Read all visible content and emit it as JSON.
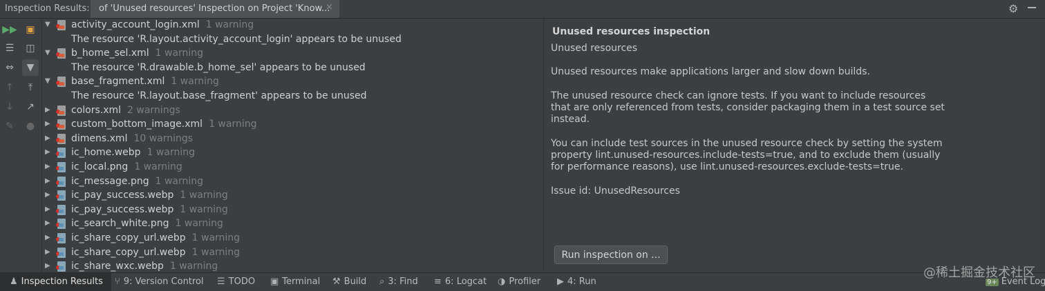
{
  "title_bar": {
    "label": "Inspection Results:",
    "tab_title": "of 'Unused resources' Inspection on Project 'Know...",
    "tab_close": "×"
  },
  "tree": [
    {
      "type": "file",
      "name": "activity_account_login.xml",
      "count": "1 warning",
      "icon": "xml-file-icon",
      "expanded": true
    },
    {
      "type": "message",
      "text": "The resource 'R.layout.activity_account_login' appears to be unused"
    },
    {
      "type": "file",
      "name": "b_home_sel.xml",
      "count": "1 warning",
      "icon": "xml-file-icon",
      "expanded": true
    },
    {
      "type": "message",
      "text": "The resource 'R.drawable.b_home_sel' appears to be unused"
    },
    {
      "type": "file",
      "name": "base_fragment.xml",
      "count": "1 warning",
      "icon": "xml-file-icon",
      "expanded": true
    },
    {
      "type": "message",
      "text": "The resource 'R.layout.base_fragment' appears to be unused"
    },
    {
      "type": "file",
      "name": "colors.xml",
      "count": "2 warnings",
      "icon": "xml-file-icon",
      "expanded": false
    },
    {
      "type": "file",
      "name": "custom_bottom_image.xml",
      "count": "1 warning",
      "icon": "xml-file-icon",
      "expanded": false
    },
    {
      "type": "file",
      "name": "dimens.xml",
      "count": "10 warnings",
      "icon": "xml-file-icon",
      "expanded": false
    },
    {
      "type": "file",
      "name": "ic_home.webp",
      "count": "1 warning",
      "icon": "image-file-icon",
      "expanded": false
    },
    {
      "type": "file",
      "name": "ic_local.png",
      "count": "1 warning",
      "icon": "image-file-icon",
      "expanded": false
    },
    {
      "type": "file",
      "name": "ic_message.png",
      "count": "1 warning",
      "icon": "image-file-icon",
      "expanded": false
    },
    {
      "type": "file",
      "name": "ic_pay_success.webp",
      "count": "1 warning",
      "icon": "image-file-icon",
      "expanded": false
    },
    {
      "type": "file",
      "name": "ic_pay_success.webp",
      "count": "1 warning",
      "icon": "image-file-icon",
      "expanded": false
    },
    {
      "type": "file",
      "name": "ic_search_white.png",
      "count": "1 warning",
      "icon": "image-file-icon",
      "expanded": false
    },
    {
      "type": "file",
      "name": "ic_share_copy_url.webp",
      "count": "1 warning",
      "icon": "image-file-icon",
      "expanded": false
    },
    {
      "type": "file",
      "name": "ic_share_copy_url.webp",
      "count": "1 warning",
      "icon": "image-file-icon",
      "expanded": false
    },
    {
      "type": "file",
      "name": "ic_share_wxc.webp",
      "count": "1 warning",
      "icon": "image-file-icon",
      "expanded": false
    }
  ],
  "panel": {
    "title": "Unused resources inspection",
    "subtitle": "Unused resources",
    "p1": "Unused resources make applications larger and slow down builds.",
    "p2": "The unused resource check can ignore tests. If you want to include resources that are only referenced from tests, consider packaging them in a test source set instead.",
    "p3": "You can include test sources in the unused resource check by setting the system property lint.unused-resources.include-tests=true, and to exclude them (usually for performance reasons), use lint.unused-resources.exclude-tests=true.",
    "issue_id": "Issue id: UnusedResources",
    "run_button": "Run inspection on ..."
  },
  "bottom_bar": {
    "inspection_results": "Inspection Results",
    "version_control": "9: Version Control",
    "todo": "TODO",
    "terminal": "Terminal",
    "build": "Build",
    "find": "3: Find",
    "logcat": "6: Logcat",
    "profiler": "Profiler",
    "run": "4: Run",
    "event_badge": "9+",
    "event_log": "Event Log"
  },
  "watermark": "@稀土掘金技术社区"
}
